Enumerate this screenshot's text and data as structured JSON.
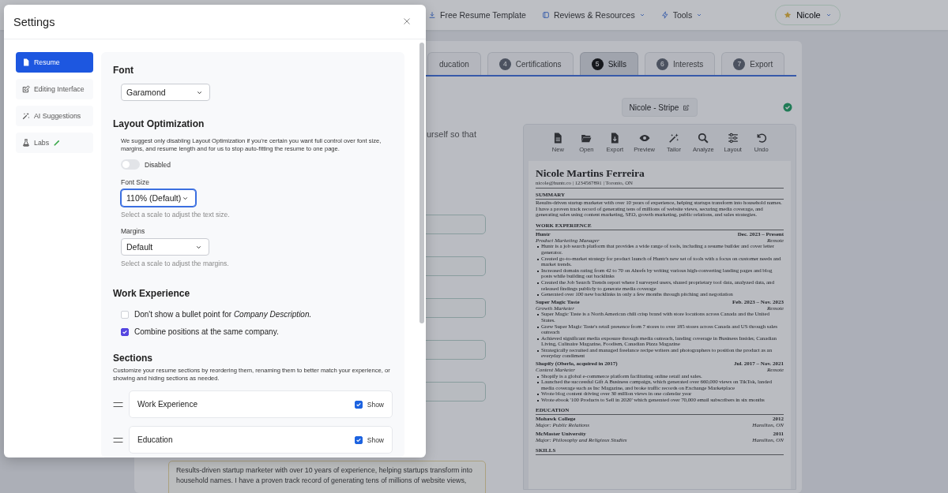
{
  "nav": {
    "items": [
      {
        "label": "Free Resume Template",
        "dropdown": false
      },
      {
        "label": "Reviews & Resources",
        "dropdown": true
      },
      {
        "label": "Tools",
        "dropdown": true
      }
    ],
    "user": {
      "name": "Nicole"
    }
  },
  "tabs": [
    {
      "label": "ducation",
      "selected": false
    },
    {
      "number": "4",
      "label": "Certifications",
      "selected": false
    },
    {
      "number": "5",
      "label": "Skills",
      "selected": true
    },
    {
      "number": "6",
      "label": "Interests",
      "selected": false
    },
    {
      "number": "7",
      "label": "Export",
      "selected": false
    }
  ],
  "editor": {
    "intro_fragment": "urself so that",
    "fields": [
      {
        "kind": "input"
      },
      {
        "kind": "input"
      },
      {
        "kind": "input"
      },
      {
        "kind": "input"
      },
      {
        "kind": "input"
      }
    ],
    "summary": {
      "value": "Results-driven startup marketer with over 10 years of experience, helping startups transform into household names. I have a proven track record of generating tens of millions of website views,"
    }
  },
  "document": {
    "title": "Nicole - Stripe",
    "saved": true
  },
  "toolbar": [
    {
      "label": "New"
    },
    {
      "label": "Open"
    },
    {
      "label": "Export"
    },
    {
      "label": "Preview"
    },
    {
      "label": "Tailor"
    },
    {
      "label": "Analyze"
    },
    {
      "label": "Layout"
    },
    {
      "label": "Undo"
    }
  ],
  "resume": {
    "name": "Nicole Martins Ferreira",
    "contact": "nicole@huntr.co | 1234567891 | Toronto, ON",
    "sections": [
      {
        "kind": "paragraph",
        "heading": "SUMMARY",
        "text": "Results-driven startup marketer with over 10 years of experience, helping startups transform into household names. I have a proven track record of generating tens of millions of website views, securing media coverage, and generating sales using content marketing, SEO, growth marketing, public relations, and sales strategies."
      },
      {
        "kind": "experience",
        "heading": "WORK EXPERIENCE",
        "entries": [
          {
            "org": "Huntr",
            "dates": "Dec. 2023 – Present",
            "role": "Product Marketing Manager",
            "location": "Remote",
            "bullets": [
              "Huntr is a job search platform that provides a wide range of tools, including a resume builder and cover letter generator.",
              "Created go-to-market strategy for product launch of Huntr's new set of tools with a focus on customer needs and market trends.",
              "Increased domain rating from 42 to 70 on Ahrefs by writing various high-converting landing pages and blog posts while building out backlinks",
              "Created the Job Search Trends report where I surveyed users, shared proprietary tool data, analyzed data, and released findings publicly to generate media coverage",
              "Generated over 100 new backlinks in only a few months through pitching and negotiation"
            ]
          },
          {
            "org": "Super Magic Taste",
            "dates": "Feb. 2023 – Nov. 2023",
            "role": "Growth Marketer",
            "location": "Remote",
            "bullets": [
              "Super Magic Taste is a North American chili crisp brand with store locations across Canada and the United States.",
              "Grew Super Magic Taste's retail presence from 7 stores to over 185 stores across Canada and US through sales outreach",
              "Achieved significant media exposure through media outreach, landing coverage in Business Insider, Canadian Living, Culinaire Magazine, Foodism, Canadian Pizza Magazine",
              "Strategically recruited and managed freelance recipe writers and photographers to position the product as an everyday condiment"
            ]
          },
          {
            "org": "Shopify (Oberlo, acquired in 2017)",
            "dates": "Jul. 2017 – Nov. 2021",
            "role": "Content Marketer",
            "location": "Remote",
            "bullets": [
              "Shopify is a global e-commerce platform facilitating online retail and sales.",
              "Launched the successful Gift A Business campaign, which generated over 660,000 views on TikTok, landed media coverage such as Inc Magazine, and broke traffic records on Exchange Marketplace",
              "Wrote blog content driving over 30 million views in one calendar year",
              "Wrote ebook '100 Products to Sell in 2020' which generated over 70,000 email subscribers in six months"
            ]
          }
        ]
      },
      {
        "kind": "education",
        "heading": "EDUCATION",
        "entries": [
          {
            "school": "Mohawk College",
            "year": "2012",
            "major": "Major: Public Relations",
            "location": "Hamilton, ON"
          },
          {
            "school": "McMaster University",
            "year": "2011",
            "major": "Major: Philosophy and Religious Studies",
            "location": "Hamilton, ON"
          }
        ]
      },
      {
        "kind": "heading",
        "heading": "SKILLS"
      }
    ]
  },
  "settings": {
    "title": "Settings",
    "nav": [
      {
        "label": "Resume",
        "selected": true
      },
      {
        "label": "Editing Interface",
        "selected": false
      },
      {
        "label": "AI Suggestions",
        "selected": false
      },
      {
        "label": "Labs",
        "selected": false
      }
    ],
    "font": {
      "heading": "Font",
      "value": "Garamond"
    },
    "layout": {
      "heading": "Layout Optimization",
      "description": "We suggest only disabling Layout Optimization if you're certain you want full control over font size, margins, and resume length and for us to stop auto-fitting the resume to one page.",
      "toggle": {
        "label": "Disabled",
        "on": false
      },
      "font_size": {
        "label": "Font Size",
        "value": "110% (Default)",
        "focused": true,
        "help": "Select a scale to adjust the text size."
      },
      "margins": {
        "label": "Margins",
        "value": "Default",
        "focused": false,
        "help": "Select a scale to adjust the margins."
      }
    },
    "work_experience": {
      "heading": "Work Experience",
      "options": [
        {
          "label": "Don't show a bullet point for *Company Description.*",
          "checked": false
        },
        {
          "label": "Combine positions at the same company.",
          "checked": true
        }
      ]
    },
    "sections": {
      "heading": "Sections",
      "description": "Customize your resume sections by reordering them, renaming them to better match your experience, or showing and hiding sections as needed.",
      "items": [
        {
          "name": "Work Experience",
          "show_label": "Show",
          "shown": true
        },
        {
          "name": "Education",
          "show_label": "Show",
          "shown": true
        }
      ]
    }
  }
}
